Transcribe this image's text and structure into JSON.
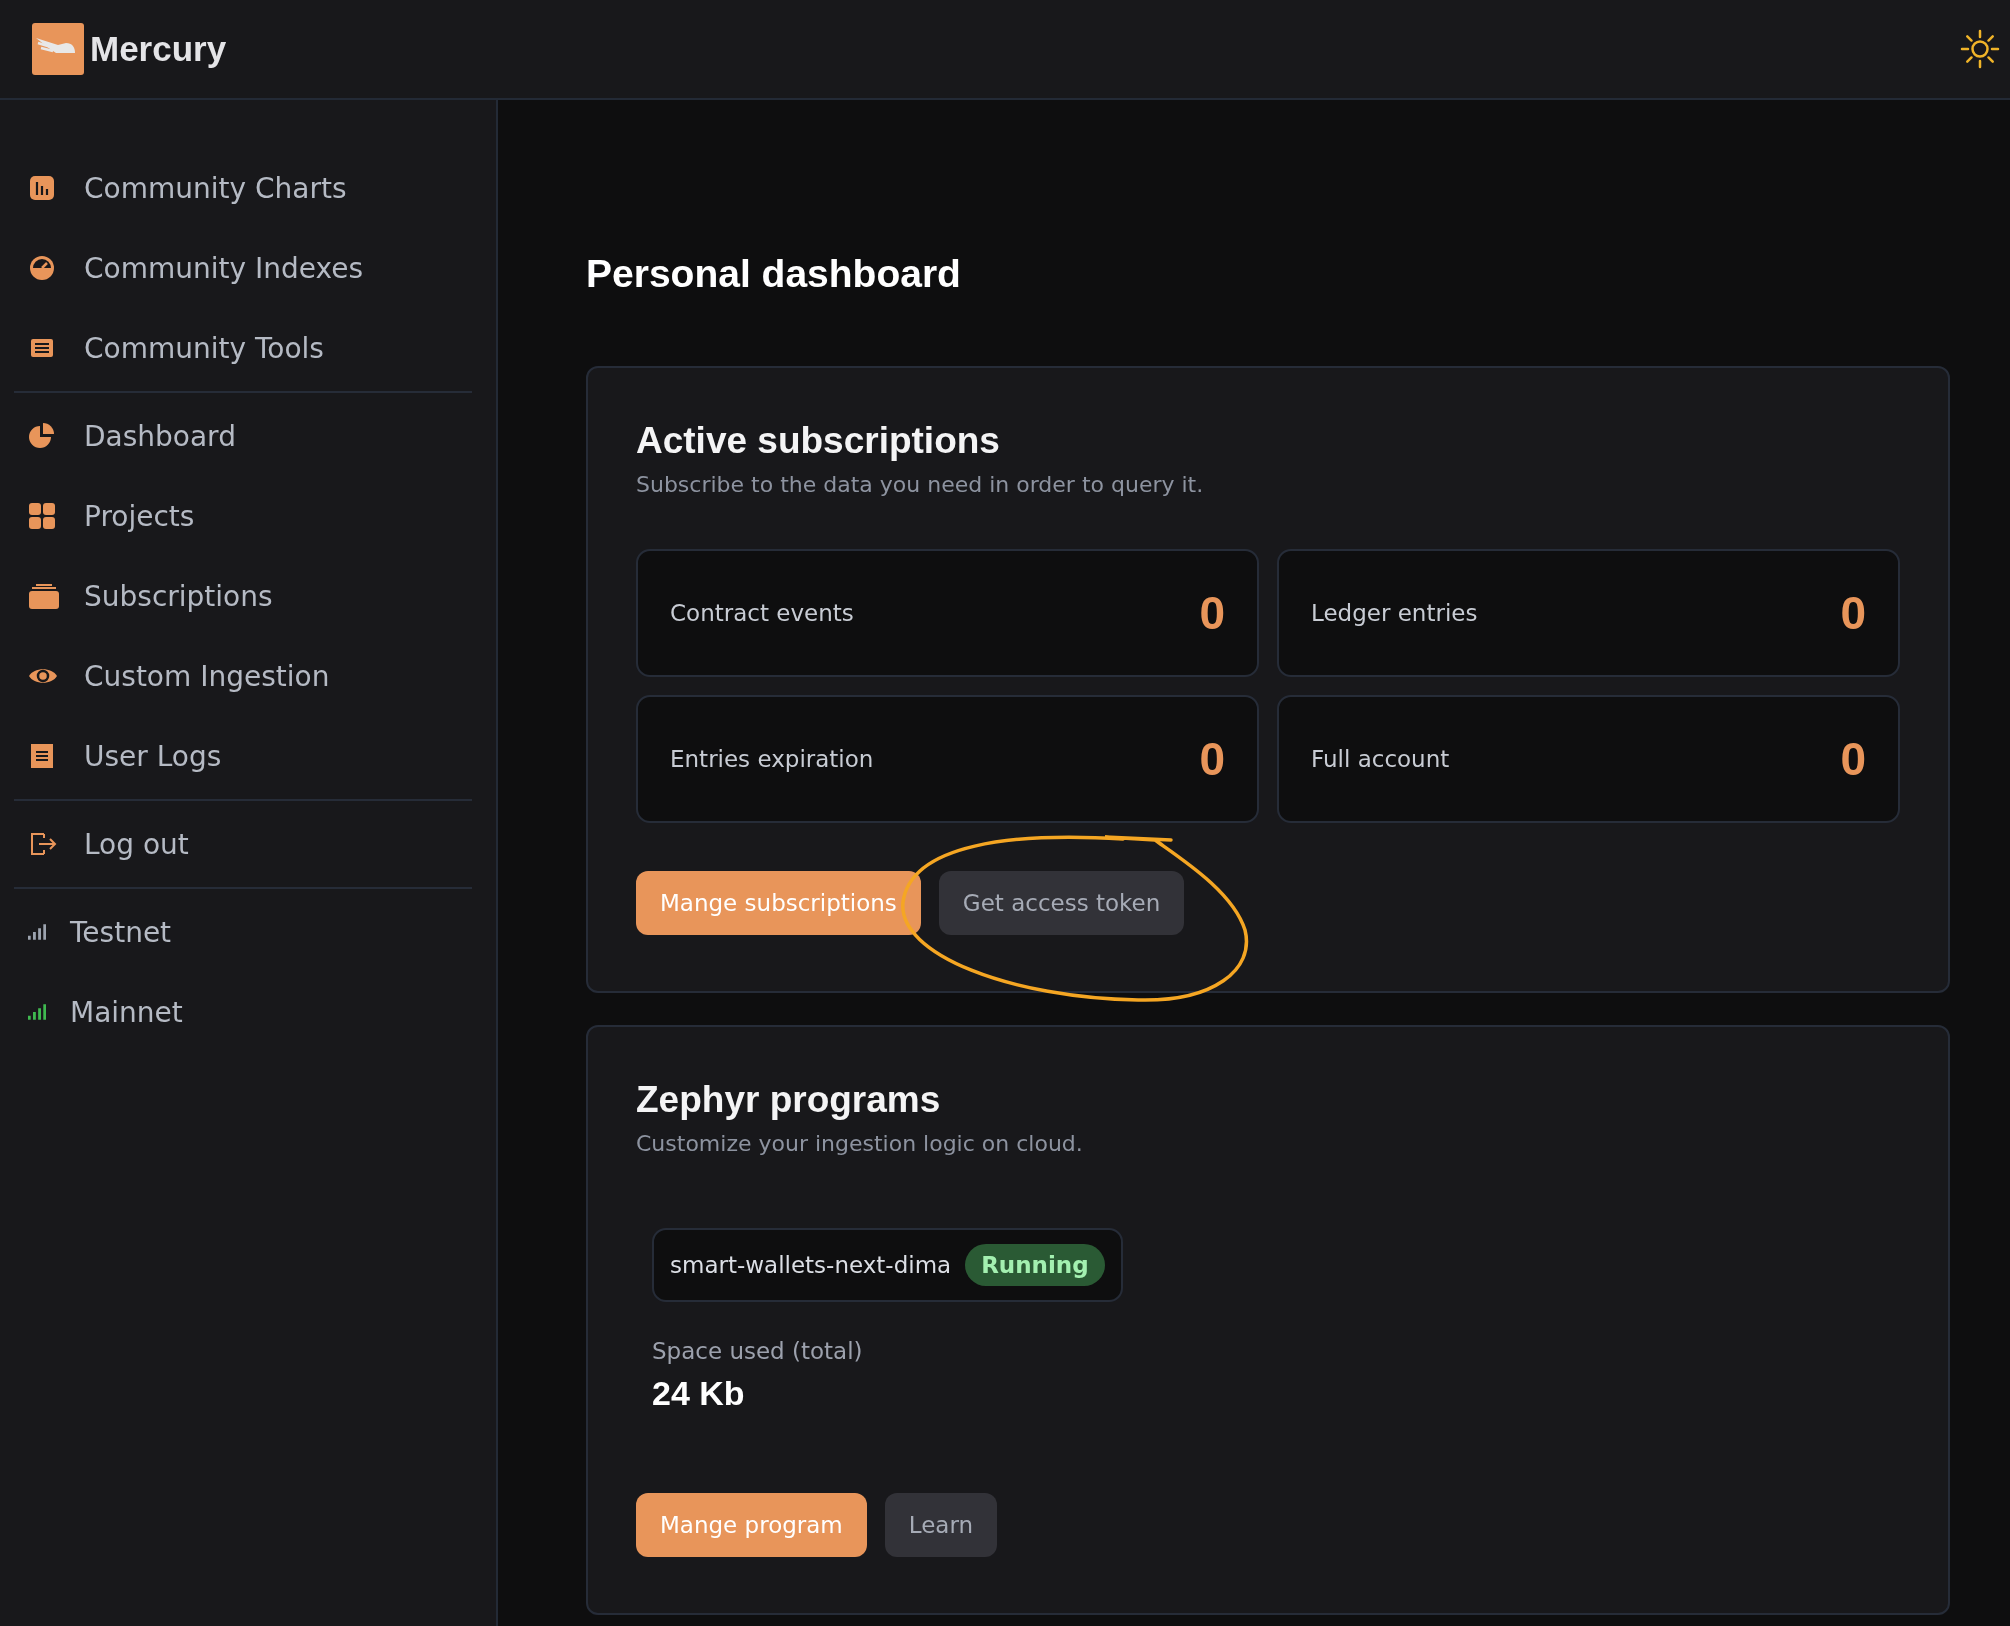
{
  "header": {
    "brand": "Mercury"
  },
  "sidebar": {
    "sections": [
      {
        "items": [
          {
            "label": "Community Charts"
          },
          {
            "label": "Community Indexes"
          },
          {
            "label": "Community Tools"
          }
        ]
      },
      {
        "items": [
          {
            "label": "Dashboard"
          },
          {
            "label": "Projects"
          },
          {
            "label": "Subscriptions"
          },
          {
            "label": "Custom Ingestion"
          },
          {
            "label": "User Logs"
          }
        ]
      },
      {
        "items": [
          {
            "label": "Log out"
          }
        ]
      }
    ],
    "networks": [
      {
        "label": "Testnet",
        "selected": false
      },
      {
        "label": "Mainnet",
        "selected": true
      }
    ]
  },
  "page_title": "Personal dashboard",
  "subscriptions": {
    "title": "Active subscriptions",
    "subtitle": "Subscribe to the data you need in order to query it.",
    "metrics": [
      {
        "label": "Contract events",
        "value": "0"
      },
      {
        "label": "Ledger entries",
        "value": "0"
      },
      {
        "label": "Entries expiration",
        "value": "0"
      },
      {
        "label": "Full account",
        "value": "0"
      }
    ],
    "buttons": [
      {
        "label": "Mange subscriptions",
        "kind": "primary"
      },
      {
        "label": "Get access token",
        "kind": "secondary"
      }
    ],
    "annotation": {
      "kind": "circle"
    }
  },
  "programs": {
    "title": "Zephyr programs",
    "subtitle": "Customize your ingestion logic on cloud.",
    "items": [
      {
        "name": "smart-wallets-next-dima",
        "status": "Running"
      }
    ],
    "space_label": "Space used (total)",
    "space_value": "24 Kb",
    "buttons": [
      {
        "label": "Mange program",
        "kind": "primary"
      },
      {
        "label": "Learn",
        "kind": "secondary"
      }
    ]
  }
}
